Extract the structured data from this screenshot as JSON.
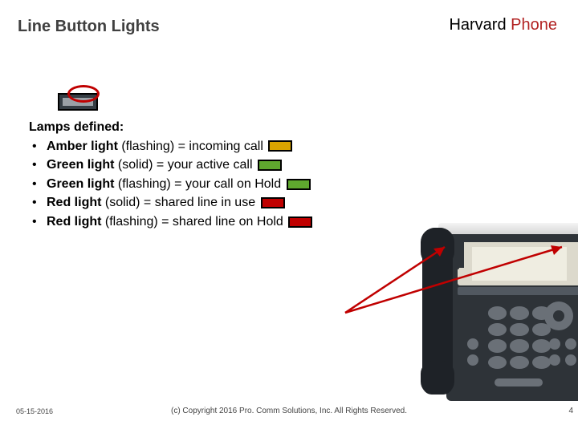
{
  "title": "Line Button Lights",
  "brand": {
    "main": "Harvard ",
    "accent": "Phone"
  },
  "content": {
    "header": "Lamps defined:",
    "bullets": [
      {
        "bold": "Amber light ",
        "rest": "(flashing) = incoming call",
        "lamp": "amber"
      },
      {
        "bold": "Green light  ",
        "rest": "(solid) = your active call",
        "lamp": "green"
      },
      {
        "bold": "Green light  ",
        "rest": "(flashing) = your call on Hold",
        "lamp": "green"
      },
      {
        "bold": "Red light  ",
        "rest": "(solid) = shared line in use",
        "lamp": "red"
      },
      {
        "bold": "Red light ",
        "rest": "(flashing) = shared line on Hold",
        "lamp": "red"
      }
    ]
  },
  "footer": {
    "date": "05-15-2016",
    "copyright": "(c) Copyright 2016 Pro. Comm Solutions, Inc. All Rights Reserved.",
    "page": "4"
  }
}
